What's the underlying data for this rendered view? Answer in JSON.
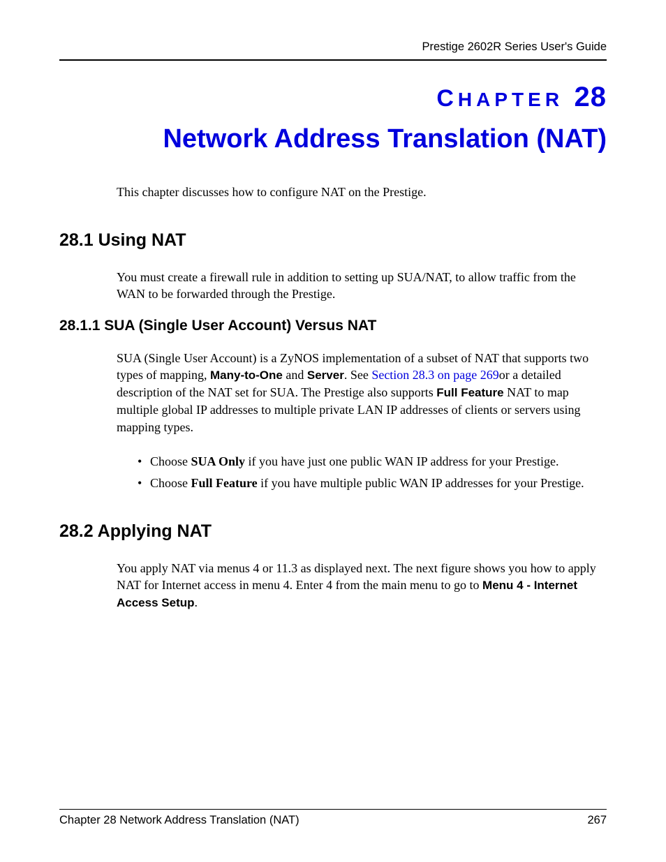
{
  "header": {
    "guide_title": "Prestige 2602R Series User's Guide"
  },
  "chapter": {
    "label_prefix": "C",
    "label_rest": "HAPTER",
    "number": "28",
    "title": "Network Address Translation (NAT)"
  },
  "intro": "This chapter discusses how to configure NAT on the Prestige.",
  "section_28_1": {
    "heading": "28.1  Using NAT",
    "body": "You must create a firewall rule in addition to setting up SUA/NAT, to allow traffic from the WAN to be forwarded through the Prestige."
  },
  "section_28_1_1": {
    "heading": "28.1.1  SUA (Single User Account) Versus NAT",
    "body_parts": {
      "p1": "SUA (Single User Account) is a ZyNOS implementation of a subset of NAT that supports two types of mapping, ",
      "bold1": "Many-to-One",
      "p2": " and ",
      "bold2": "Server",
      "p3": ". See ",
      "link": "Section 28.3 on page 269",
      "p4": "or a detailed description of the NAT set for SUA. The Prestige also supports ",
      "bold3": "Full Feature",
      "p5": " NAT to map multiple global IP addresses to multiple private LAN IP addresses of clients or servers using mapping types."
    },
    "bullets": [
      {
        "pre": "Choose ",
        "bold": "SUA Only",
        "post": " if you have just one public WAN IP address for your Prestige."
      },
      {
        "pre": "Choose ",
        "bold": "Full Feature",
        "post": " if you have multiple public WAN IP addresses for your Prestige."
      }
    ]
  },
  "section_28_2": {
    "heading": "28.2  Applying NAT",
    "body_parts": {
      "p1": "You apply NAT via menus 4 or 11.3 as displayed next. The next figure shows you how to apply NAT for Internet access in menu 4. Enter 4 from the main menu to go to ",
      "bold1": "Menu 4 - Internet Access Setup",
      "p2": "."
    }
  },
  "footer": {
    "left": "Chapter 28 Network Address Translation (NAT)",
    "right": "267"
  }
}
